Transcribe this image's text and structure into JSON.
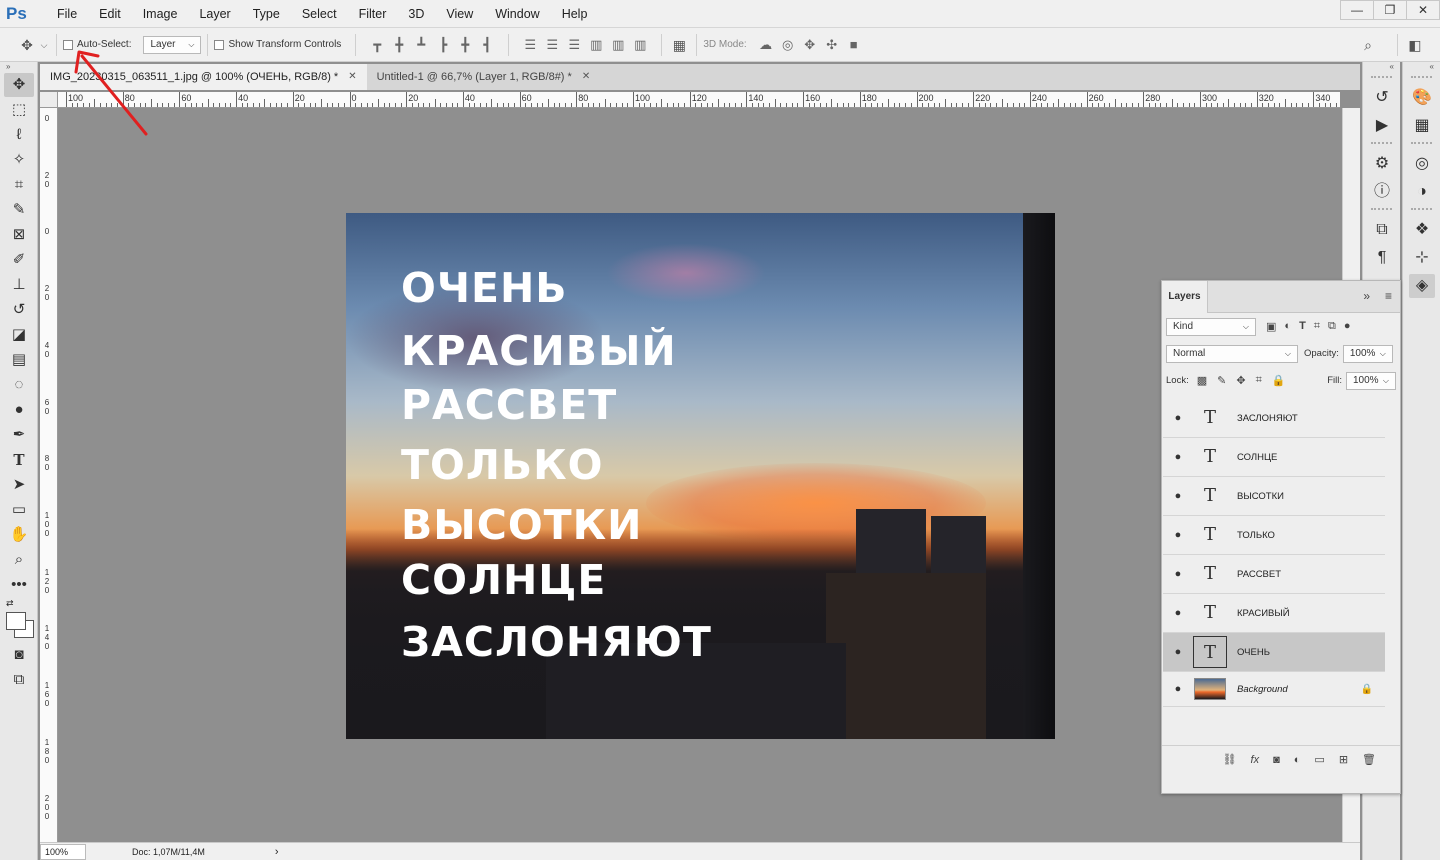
{
  "app": {
    "logo": "Ps"
  },
  "menu": [
    "File",
    "Edit",
    "Image",
    "Layer",
    "Type",
    "Select",
    "Filter",
    "3D",
    "View",
    "Window",
    "Help"
  ],
  "window_controls": [
    "—",
    "❐",
    "✕"
  ],
  "options": {
    "auto_select_label": "Auto-Select:",
    "auto_select_value": "Layer",
    "show_transform_label": "Show Transform Controls",
    "mode_label": "3D Mode:"
  },
  "tabs": [
    {
      "label": "IMG_20230315_063511_1.jpg @ 100% (ОЧЕНЬ, RGB/8) *",
      "close": "✕"
    },
    {
      "label": "Untitled-1 @ 66,7% (Layer 1, RGB/8#) *",
      "close": "✕"
    }
  ],
  "ruler_top": [
    "100",
    "80",
    "60",
    "40",
    "20",
    "0",
    "20",
    "40",
    "60",
    "80",
    "100",
    "120",
    "140",
    "160",
    "180",
    "200",
    "220",
    "240",
    "260",
    "280",
    "300",
    "320",
    "340"
  ],
  "ruler_left": [
    "0",
    "2 0",
    "0",
    "2 0",
    "4 0",
    "6 0",
    "8 0",
    "1 0 0",
    "1 2 0",
    "1 4 0",
    "1 6 0",
    "1 8 0",
    "2 0 0"
  ],
  "image_text": [
    "ОЧЕНЬ",
    "КРАСИВЫЙ",
    "РАССВЕТ",
    "ТОЛЬКО",
    "ВЫСОТКИ",
    "СОЛНЦЕ",
    "ЗАСЛОНЯЮТ"
  ],
  "status": {
    "zoom": "100%",
    "doc": "Doc: 1,07M/11,4M",
    "arrow": "›"
  },
  "layers_panel": {
    "tab": "Layers",
    "filter_label": "Kind",
    "blend_mode": "Normal",
    "opacity_label": "Opacity:",
    "opacity_value": "100%",
    "lock_label": "Lock:",
    "fill_label": "Fill:",
    "fill_value": "100%",
    "layers": [
      {
        "name": "ЗАСЛОНЯЮТ",
        "type": "text"
      },
      {
        "name": "СОЛНЦЕ",
        "type": "text"
      },
      {
        "name": "ВЫСОТКИ",
        "type": "text"
      },
      {
        "name": "ТОЛЬКО",
        "type": "text"
      },
      {
        "name": "РАССВЕТ",
        "type": "text"
      },
      {
        "name": "КРАСИВЫЙ",
        "type": "text"
      },
      {
        "name": "ОЧЕНЬ",
        "type": "text",
        "selected": true
      },
      {
        "name": "Background",
        "type": "image",
        "locked": true
      }
    ],
    "text_thumb": "T",
    "eye": "●"
  },
  "colors": {
    "accent": "#2a6fb8",
    "annotation_arrow": "#e02020"
  }
}
